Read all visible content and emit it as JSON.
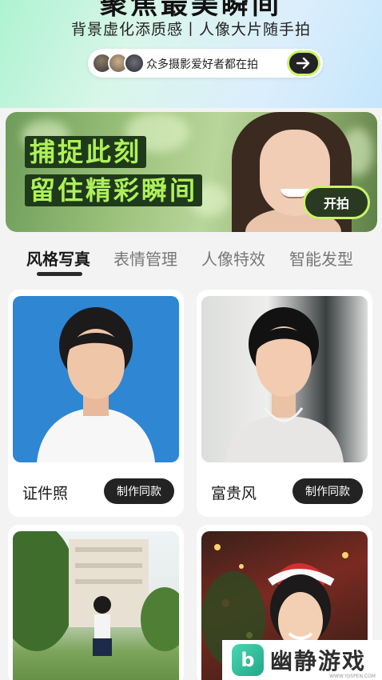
{
  "hero": {
    "title": "聚焦最美瞬间",
    "subtitle": "背景虚化添质感丨人像大片随手拍",
    "community_text": "众多摄影爱好者都在拍",
    "arrow_icon": "arrow-right-icon"
  },
  "banner": {
    "line1": "捕捉此刻",
    "line2": "留住精彩瞬间",
    "button_label": "开拍",
    "accent_color": "#c8f36a"
  },
  "tabs": [
    {
      "label": "风格写真",
      "active": true
    },
    {
      "label": "表情管理",
      "active": false
    },
    {
      "label": "人像特效",
      "active": false
    },
    {
      "label": "智能发型",
      "active": false
    }
  ],
  "cards": [
    {
      "title": "证件照",
      "button": "制作同款"
    },
    {
      "title": "富贵风",
      "button": "制作同款"
    },
    {
      "title": "",
      "button": ""
    },
    {
      "title": "",
      "button": ""
    }
  ],
  "watermark": {
    "brand": "幽静游戏",
    "logo_glyph": "b",
    "url": "WWW.YJISPEN.COM"
  }
}
